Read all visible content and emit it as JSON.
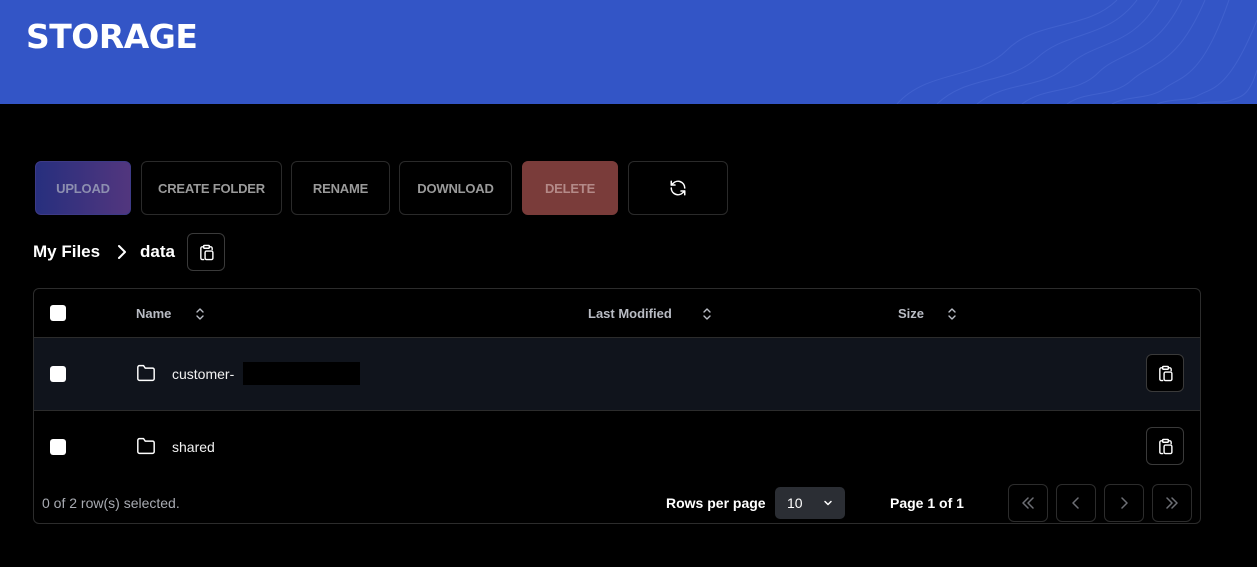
{
  "header": {
    "title": "STORAGE",
    "accent_color": "#3355c6"
  },
  "toolbar": {
    "upload_label": "UPLOAD",
    "create_folder_label": "CREATE FOLDER",
    "rename_label": "RENAME",
    "download_label": "DOWNLOAD",
    "delete_label": "DELETE",
    "refresh_icon": "refresh-icon"
  },
  "breadcrumb": {
    "root": "My Files",
    "current": "data"
  },
  "table": {
    "columns": {
      "name": "Name",
      "last_modified": "Last Modified",
      "size": "Size"
    },
    "rows": [
      {
        "name": "customer-",
        "type": "folder",
        "last_modified": "",
        "size": ""
      },
      {
        "name": "shared",
        "type": "folder",
        "last_modified": "",
        "size": ""
      }
    ]
  },
  "footer": {
    "selection_status": "0 of 2 row(s) selected.",
    "rows_per_page_label": "Rows per page",
    "rows_per_page_value": "10",
    "page_indicator": "Page 1 of 1"
  }
}
